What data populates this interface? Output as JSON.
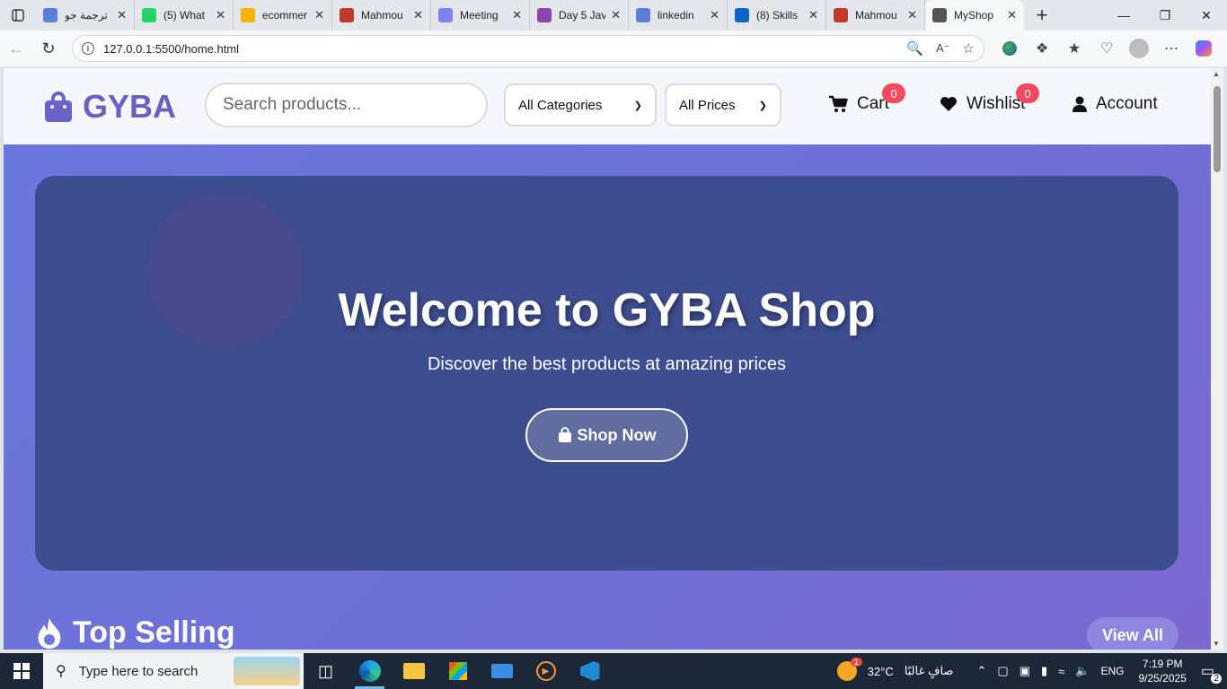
{
  "browser": {
    "tabs": [
      {
        "label": "ترجمة جو",
        "icon": "search-icon",
        "color": "#5b7fd6",
        "active": false
      },
      {
        "label": "(5) What",
        "icon": "whatsapp-icon",
        "color": "#25d366",
        "active": false
      },
      {
        "label": "ecommer",
        "icon": "google-drive-icon",
        "color": "#f4b400",
        "active": false
      },
      {
        "label": "Mahmou",
        "icon": "pdf-icon",
        "color": "#c0392b",
        "active": false
      },
      {
        "label": "Meeting",
        "icon": "teams-icon",
        "color": "#7b83eb",
        "active": false
      },
      {
        "label": "Day 5 Jav",
        "icon": "video-icon",
        "color": "#8e44ad",
        "active": false
      },
      {
        "label": "linkedin",
        "icon": "search-icon",
        "color": "#5b7fd6",
        "active": false
      },
      {
        "label": "(8) Skills",
        "icon": "linkedin-icon",
        "color": "#0a66c2",
        "active": false
      },
      {
        "label": "Mahmou",
        "icon": "pdf-icon",
        "color": "#c0392b",
        "active": false
      },
      {
        "label": "MyShop",
        "icon": "globe-icon",
        "color": "#555555",
        "active": true
      }
    ],
    "url": "127.0.0.1:5500/home.html"
  },
  "site": {
    "logo": "GYBA",
    "search_placeholder": "Search products...",
    "category_select": "All Categories",
    "price_select": "All Prices",
    "cart_label": "Cart",
    "cart_count": "0",
    "wishlist_label": "Wishlist",
    "wishlist_count": "0",
    "account_label": "Account",
    "accent_color": "#6b5fc4",
    "badge_color": "#f04a5e"
  },
  "hero": {
    "title": "Welcome to GYBA Shop",
    "subtitle": "Discover the best products at amazing prices",
    "button": "Shop Now",
    "background_color": "#3e4d8f"
  },
  "section": {
    "title": "Top Selling",
    "view_all": "View All"
  },
  "taskbar": {
    "search_placeholder": "Type here to search",
    "weather_temp": "32°C",
    "weather_text": "صافٍ غالبًا",
    "weather_badge": "1",
    "language": "ENG",
    "time": "7:19 PM",
    "date": "9/25/2025",
    "notification_count": "2"
  }
}
